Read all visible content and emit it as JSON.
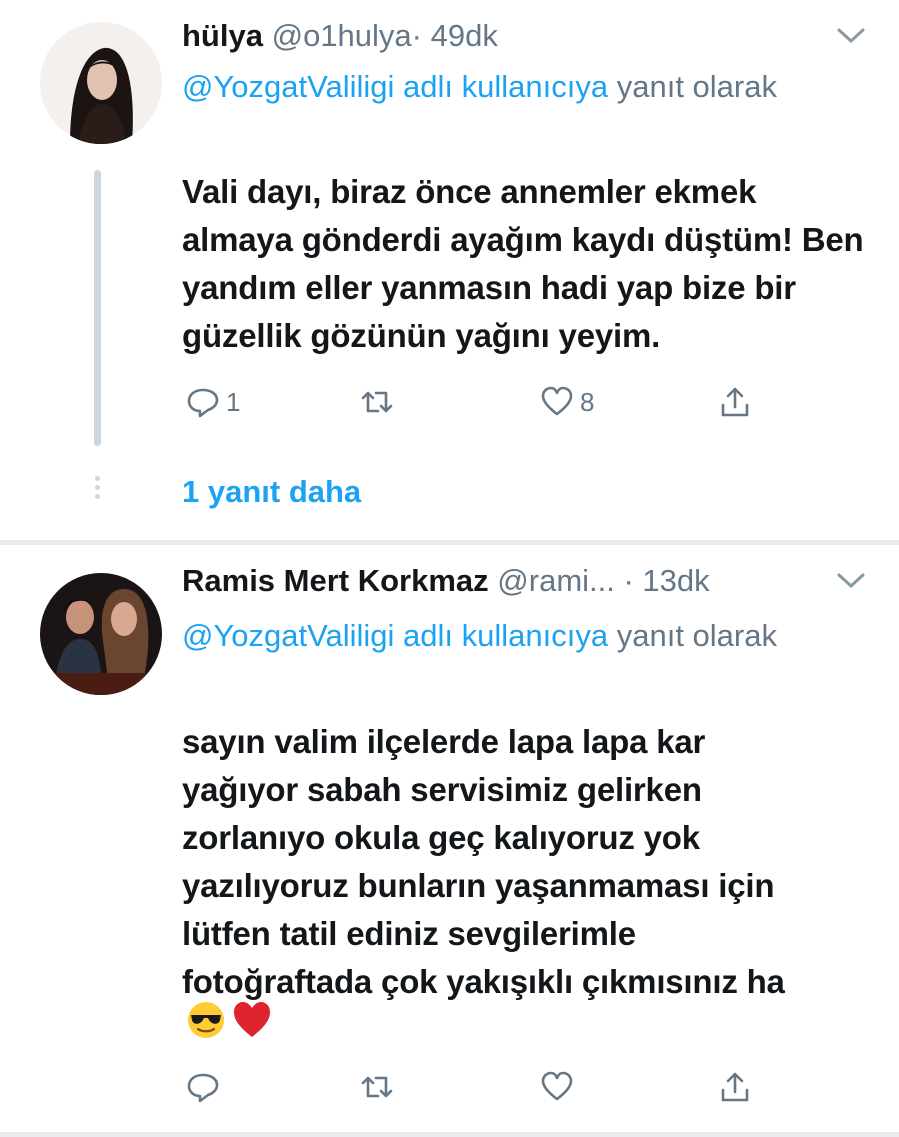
{
  "tweets": [
    {
      "display_name": "hülya",
      "handle": "@o1hulya",
      "time": "· 49dk",
      "reply_link": "@YozgatValiligi adlı kullanıcıya",
      "reply_suffix": " yanıt olarak",
      "body": "Vali dayı, biraz önce annemler ekmek almaya gönderdi ayağım kaydı düştüm! Ben yandım eller yanmasın hadi yap bize bir güzellik gözünün yağını yeyim.",
      "reply_count": "1",
      "like_count": "8",
      "more_replies": "1 yanıt daha"
    },
    {
      "display_name": "Ramis Mert Korkmaz",
      "handle": "@rami...",
      "time": "· 13dk",
      "reply_link": "@YozgatValiligi adlı kullanıcıya",
      "reply_suffix": " yanıt olarak",
      "body_lines": [
        "sayın valim ilçelerde lapa lapa kar",
        "yağıyor sabah servisimiz gelirken",
        "zorlanıyo okula geç kalıyoruz yok",
        "yazılıyoruz bunların yaşanmaması için",
        "lütfen tatil ediniz sevgilerimle",
        "fotoğraftada çok yakışıklı çıkmısınız ha"
      ],
      "emojis": [
        "sunglasses-emoji",
        "red-heart-emoji"
      ],
      "reply_count": "",
      "like_count": ""
    }
  ],
  "icons": [
    "reply-icon",
    "retweet-icon",
    "like-icon",
    "share-icon",
    "chevron-down-icon"
  ],
  "colors": {
    "accent": "#1da1f2",
    "secondary_text": "#657786",
    "divider": "#e6ecf0"
  }
}
